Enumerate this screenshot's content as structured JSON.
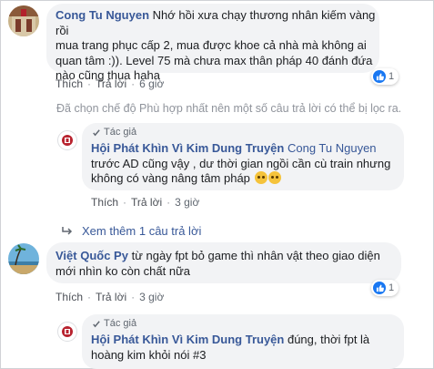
{
  "comments": [
    {
      "author": "Cong Tu Nguyen",
      "lines": [
        "Nhớ hồi xưa chạy thương nhân kiếm vàng rồi",
        "mua trang phục cấp 2, mua được khoe cả nhà mà không ai",
        "quan tâm :)). Level 75 mà chưa max thân pháp 40 đánh đứa",
        "nào cũng thua haha"
      ],
      "like_label": "Thích",
      "reply_label": "Trả lời",
      "time": "6 giờ",
      "reactions": "1",
      "filter_note": "Đã chọn chế độ Phù hợp nhất nên một số câu trả lời có thể bị lọc ra.",
      "reply": {
        "badge": "Tác giả",
        "author": "Hội Phát Khìn Vì Kim Dung Truyện",
        "mention": "Cong Tu Nguyen",
        "lines": [
          "trước AD cũng vậy , dư thời gian ngồi cần cù train nhưng",
          "không có vàng nâng tâm pháp"
        ],
        "like_label": "Thích",
        "reply_label": "Trả lời",
        "time": "3 giờ"
      },
      "see_more": "Xem thêm 1 câu trả lời"
    },
    {
      "author": "Việt Quốc Py",
      "lines": [
        "từ ngày fpt bỏ game thì nhân vật theo giao diện",
        "mới nhìn ko còn chất nữa"
      ],
      "like_label": "Thích",
      "reply_label": "Trả lời",
      "time": "3 giờ",
      "reactions": "1",
      "reply": {
        "badge": "Tác giả",
        "author": "Hội Phát Khìn Vì Kim Dung Truyện",
        "lines": [
          "đúng, thời fpt là",
          "hoàng kim khỏi nói #3"
        ]
      }
    }
  ],
  "colors": {
    "name": "#385898",
    "bubble": "#f2f3f5",
    "like_blue": "#1877f2",
    "muted": "#606770"
  }
}
